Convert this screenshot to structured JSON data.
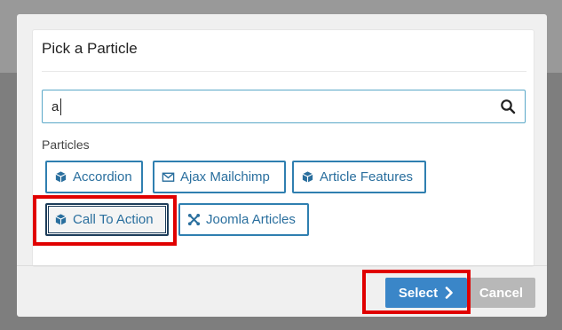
{
  "modal": {
    "title": "Pick a Particle",
    "search": {
      "value": "a",
      "placeholder": ""
    },
    "section_label": "Particles",
    "particles": [
      {
        "label": "Accordion",
        "icon": "cube-icon",
        "selected": false
      },
      {
        "label": "Ajax Mailchimp",
        "icon": "envelope-icon",
        "selected": false
      },
      {
        "label": "Article Features",
        "icon": "cube-icon",
        "selected": false
      },
      {
        "label": "Call To Action",
        "icon": "cube-icon",
        "selected": true
      },
      {
        "label": "Joomla Articles",
        "icon": "joomla-icon",
        "selected": false
      }
    ],
    "footer": {
      "select_label": "Select",
      "cancel_label": "Cancel"
    }
  },
  "colors": {
    "accent": "#3a86c8",
    "particle_text": "#2a6f9e",
    "highlight": "#e00000",
    "cancel_bg": "#b8b8b8"
  }
}
